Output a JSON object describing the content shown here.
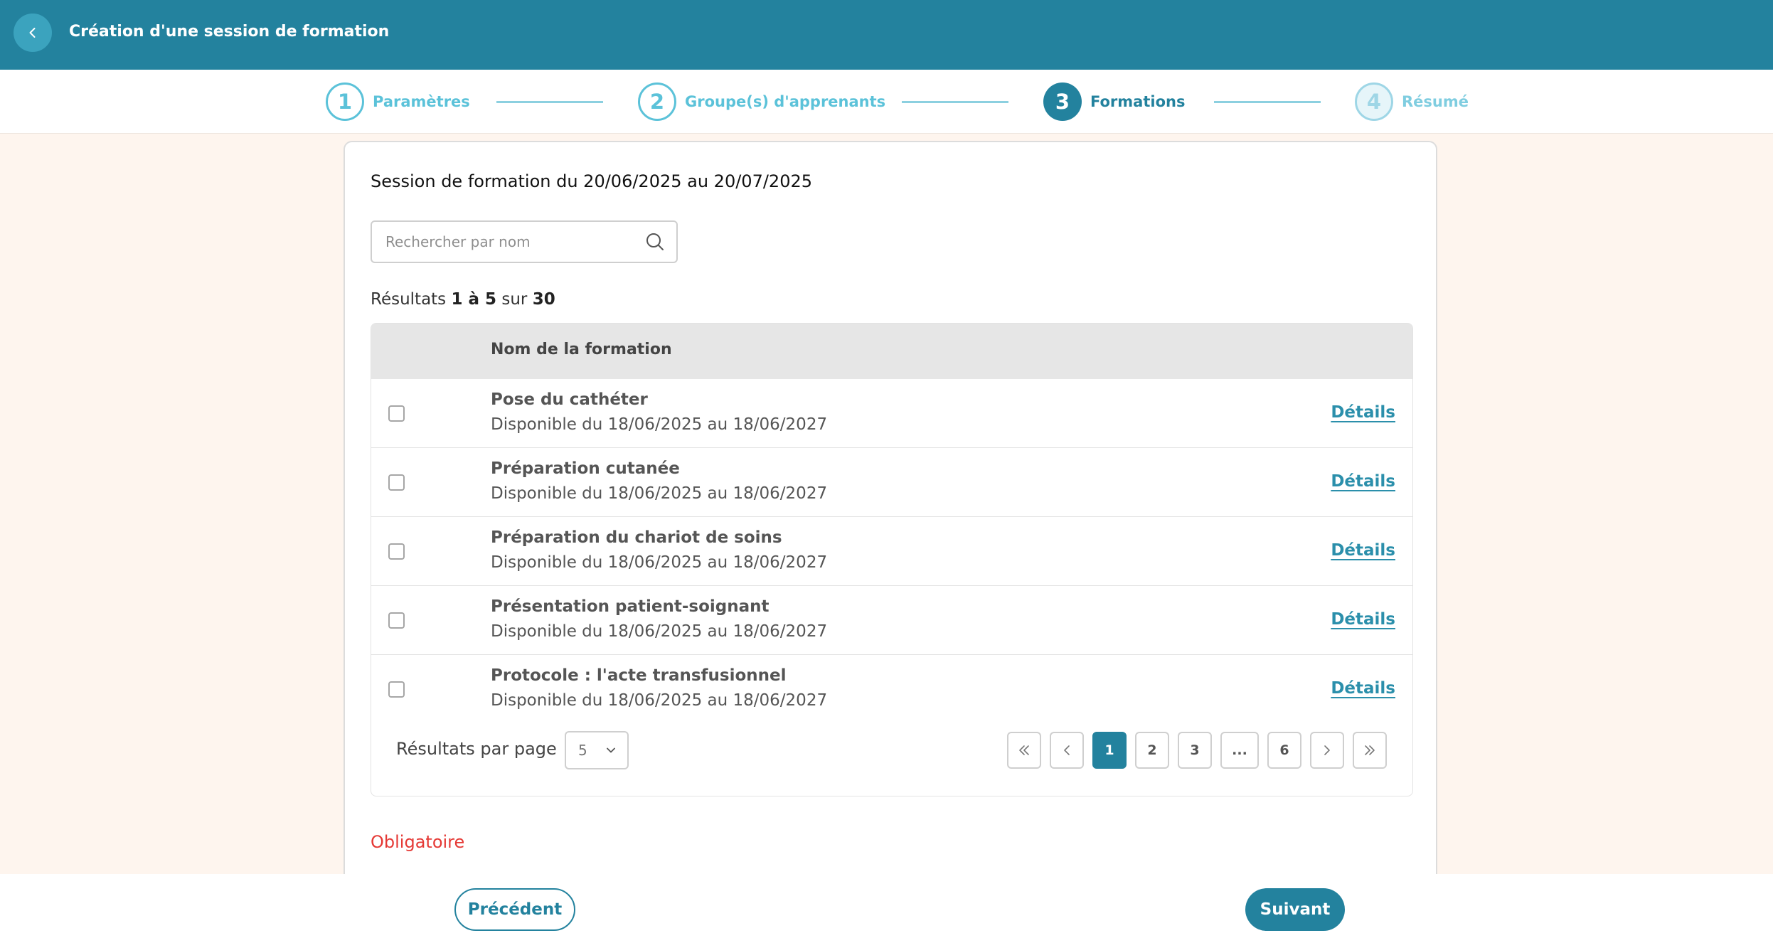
{
  "header": {
    "title": "Création d'une session de formation",
    "back_icon": "chevron-left-icon"
  },
  "stepper": {
    "steps": [
      {
        "number": "1",
        "label": "Paramètres",
        "state": "done"
      },
      {
        "number": "2",
        "label": "Groupe(s) d'apprenants",
        "state": "done"
      },
      {
        "number": "3",
        "label": "Formations",
        "state": "active"
      },
      {
        "number": "4",
        "label": "Résumé",
        "state": "todo"
      }
    ]
  },
  "session": {
    "title": "Session de formation du 20/06/2025 au 20/07/2025"
  },
  "search": {
    "placeholder": "Rechercher par nom",
    "value": ""
  },
  "results": {
    "prefix": "Résultats",
    "range": "1 à 5",
    "sur": "sur",
    "total": "30"
  },
  "table": {
    "column_header": "Nom de la formation",
    "details_label": "Détails",
    "rows": [
      {
        "name": "Pose du cathéter",
        "dates": "Disponible du 18/06/2025 au 18/06/2027",
        "checked": false
      },
      {
        "name": "Préparation cutanée",
        "dates": "Disponible du 18/06/2025 au 18/06/2027",
        "checked": false
      },
      {
        "name": "Préparation du chariot de soins",
        "dates": "Disponible du 18/06/2025 au 18/06/2027",
        "checked": false
      },
      {
        "name": "Présentation patient-soignant",
        "dates": "Disponible du 18/06/2025 au 18/06/2027",
        "checked": false
      },
      {
        "name": "Protocole : l'acte transfusionnel",
        "dates": "Disponible du 18/06/2025 au 18/06/2027",
        "checked": false
      }
    ]
  },
  "pagination": {
    "per_page_label": "Résultats par page",
    "per_page_value": "5",
    "pages": [
      "1",
      "2",
      "3",
      "...",
      "6"
    ],
    "current_page": "1"
  },
  "validation": {
    "required_text": "Obligatoire"
  },
  "footer": {
    "prev_label": "Précédent",
    "next_label": "Suivant"
  },
  "colors": {
    "primary": "#23829e",
    "accent_light": "#5bc2d9",
    "background": "#fef5ee",
    "error": "#e53935"
  }
}
